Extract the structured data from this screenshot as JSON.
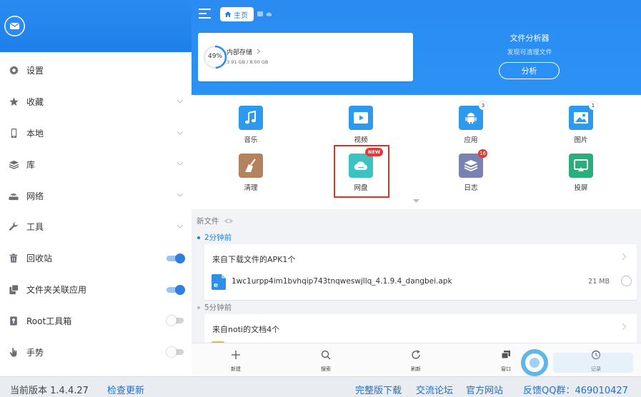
{
  "sidebar": {
    "items": [
      {
        "label": "设置",
        "icon": "gear-icon",
        "control": "none"
      },
      {
        "label": "收藏",
        "icon": "star-icon",
        "control": "chevron"
      },
      {
        "label": "本地",
        "icon": "phone-icon",
        "control": "chevron"
      },
      {
        "label": "库",
        "icon": "layers-icon",
        "control": "chevron"
      },
      {
        "label": "网络",
        "icon": "router-icon",
        "control": "chevron"
      },
      {
        "label": "工具",
        "icon": "wrench-icon",
        "control": "chevron"
      },
      {
        "label": "回收站",
        "icon": "trash-icon",
        "control": "toggle-on"
      },
      {
        "label": "文件夹关联应用",
        "icon": "folder-app-icon",
        "control": "toggle-on"
      },
      {
        "label": "Root工具箱",
        "icon": "root-box-icon",
        "control": "toggle-off"
      },
      {
        "label": "手势",
        "icon": "hand-icon",
        "control": "toggle-off"
      }
    ]
  },
  "header": {
    "home_label": "主页"
  },
  "storage": {
    "percent_text": "49%",
    "percent_value": 49,
    "name": "内部存储",
    "size_text": "3.91 GB / 8.00 GB"
  },
  "analyzer": {
    "title": "文件分析器",
    "subtitle": "发现可清理文件",
    "button": "分析"
  },
  "categories": [
    {
      "label": "音乐",
      "icon": "music-icon",
      "color": "#2d9af0",
      "badge": ""
    },
    {
      "label": "视频",
      "icon": "video-icon",
      "color": "#2d9af0",
      "badge": ""
    },
    {
      "label": "应用",
      "icon": "android-icon",
      "color": "#2d9af0",
      "badge": "3"
    },
    {
      "label": "图片",
      "icon": "image-icon",
      "color": "#2d9af0",
      "badge": "1"
    },
    {
      "label": "清理",
      "icon": "broom-icon",
      "color": "#b4835e",
      "badge": ""
    },
    {
      "label": "网盘",
      "icon": "cloud-icon",
      "color": "#3cc2c0",
      "badge": "NEW"
    },
    {
      "label": "日志",
      "icon": "log-icon",
      "color": "#7982b0",
      "badge": "16"
    },
    {
      "label": "投屏",
      "icon": "cast-icon",
      "color": "#2aae7c",
      "badge": ""
    }
  ],
  "recent": {
    "title": "新文件",
    "groups": [
      {
        "time": "2分钟前",
        "title": "来自下载文件的APK1个",
        "file": {
          "name": "1wc1urpp4im1bvhqip743tnqweswjllq_4.1.9.4_dangbei.apk",
          "size": "21 MB"
        }
      },
      {
        "time": "5分钟前",
        "title": "来自noti的文档4个"
      }
    ]
  },
  "bottom_bar": [
    {
      "label": "新建",
      "icon": "plus-icon"
    },
    {
      "label": "搜索",
      "icon": "search-icon"
    },
    {
      "label": "刷新",
      "icon": "refresh-icon"
    },
    {
      "label": "窗口",
      "icon": "windows-icon"
    },
    {
      "label": "记录",
      "icon": "history-icon"
    }
  ],
  "footer": {
    "version": "当前版本 1.4.4.27",
    "check_update": "检查更新",
    "full_download": "完整版下载",
    "forum": "交流论坛",
    "website": "官方网站",
    "feedback": "反馈QQ群：469010427"
  },
  "colors": {
    "primary_blue": "#2a8cf2",
    "highlight_red": "#d9342c",
    "link_blue": "#1f6fce"
  }
}
